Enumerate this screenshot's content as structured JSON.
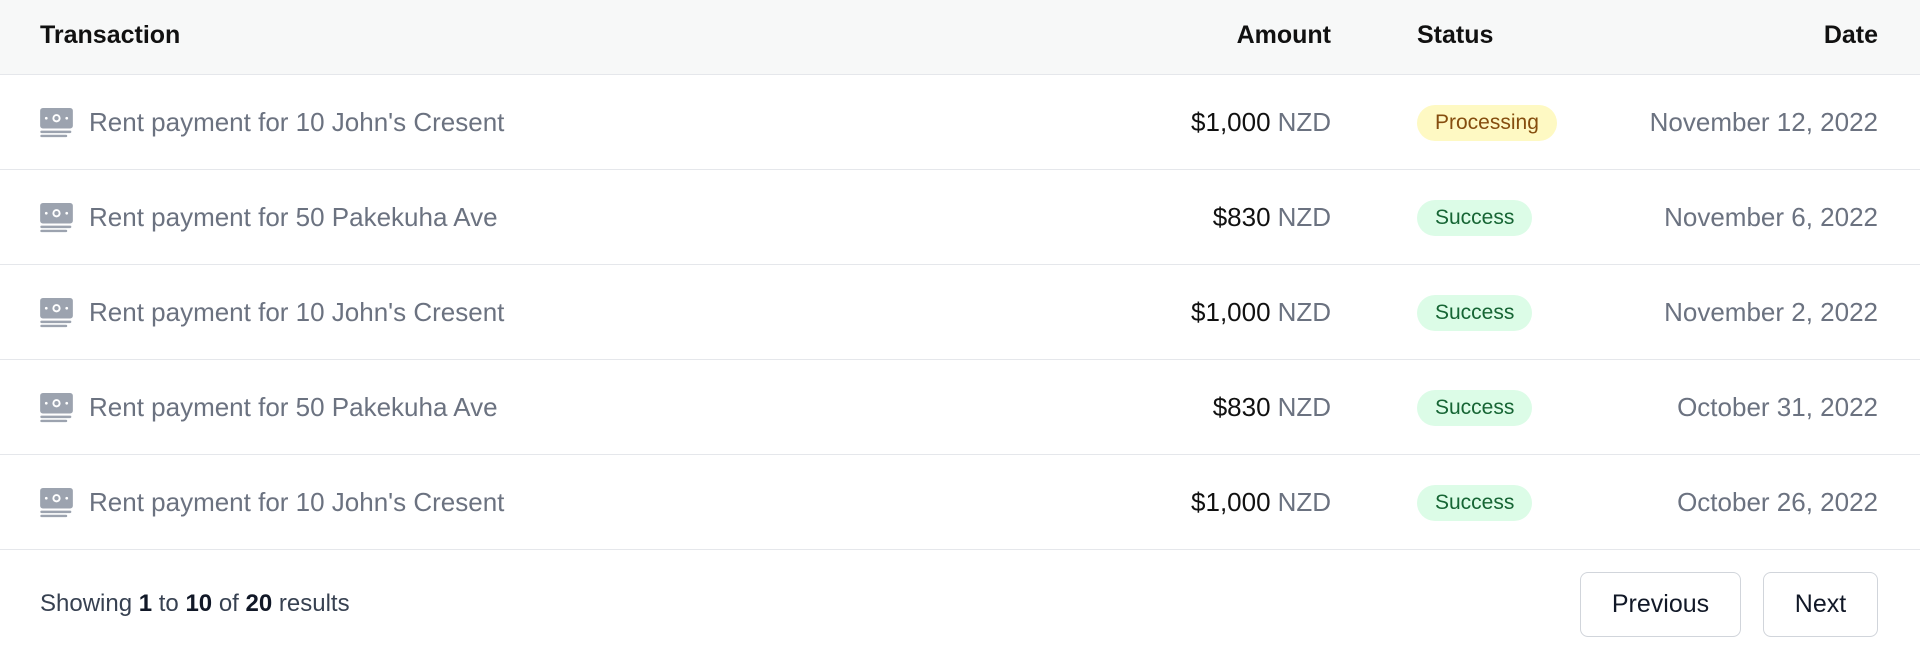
{
  "table": {
    "headers": {
      "transaction": "Transaction",
      "amount": "Amount",
      "status": "Status",
      "date": "Date"
    },
    "rows": [
      {
        "icon": "money-icon",
        "description": "Rent payment for 10 John's Cresent",
        "amount": "$1,000",
        "currency": "NZD",
        "status": "Processing",
        "date": "November 12, 2022"
      },
      {
        "icon": "money-icon",
        "description": "Rent payment for 50 Pakekuha Ave",
        "amount": "$830",
        "currency": "NZD",
        "status": "Success",
        "date": "November 6, 2022"
      },
      {
        "icon": "money-icon",
        "description": "Rent payment for 10 John's Cresent",
        "amount": "$1,000",
        "currency": "NZD",
        "status": "Success",
        "date": "November 2, 2022"
      },
      {
        "icon": "money-icon",
        "description": "Rent payment for 50 Pakekuha Ave",
        "amount": "$830",
        "currency": "NZD",
        "status": "Success",
        "date": "October 31, 2022"
      },
      {
        "icon": "money-icon",
        "description": "Rent payment for 10 John's Cresent",
        "amount": "$1,000",
        "currency": "NZD",
        "status": "Success",
        "date": "October 26, 2022"
      }
    ]
  },
  "pagination": {
    "showing_prefix": "Showing",
    "from": "1",
    "to_word": "to",
    "to": "10",
    "of_word": "of",
    "total": "20",
    "results_word": "results",
    "previous_label": "Previous",
    "next_label": "Next"
  },
  "colors": {
    "processing_badge_bg": "#fef9c3",
    "processing_badge_text": "#854d0e",
    "success_badge_bg": "#dcfce7",
    "success_badge_text": "#166534",
    "header_bg": "#f7f8f8"
  }
}
